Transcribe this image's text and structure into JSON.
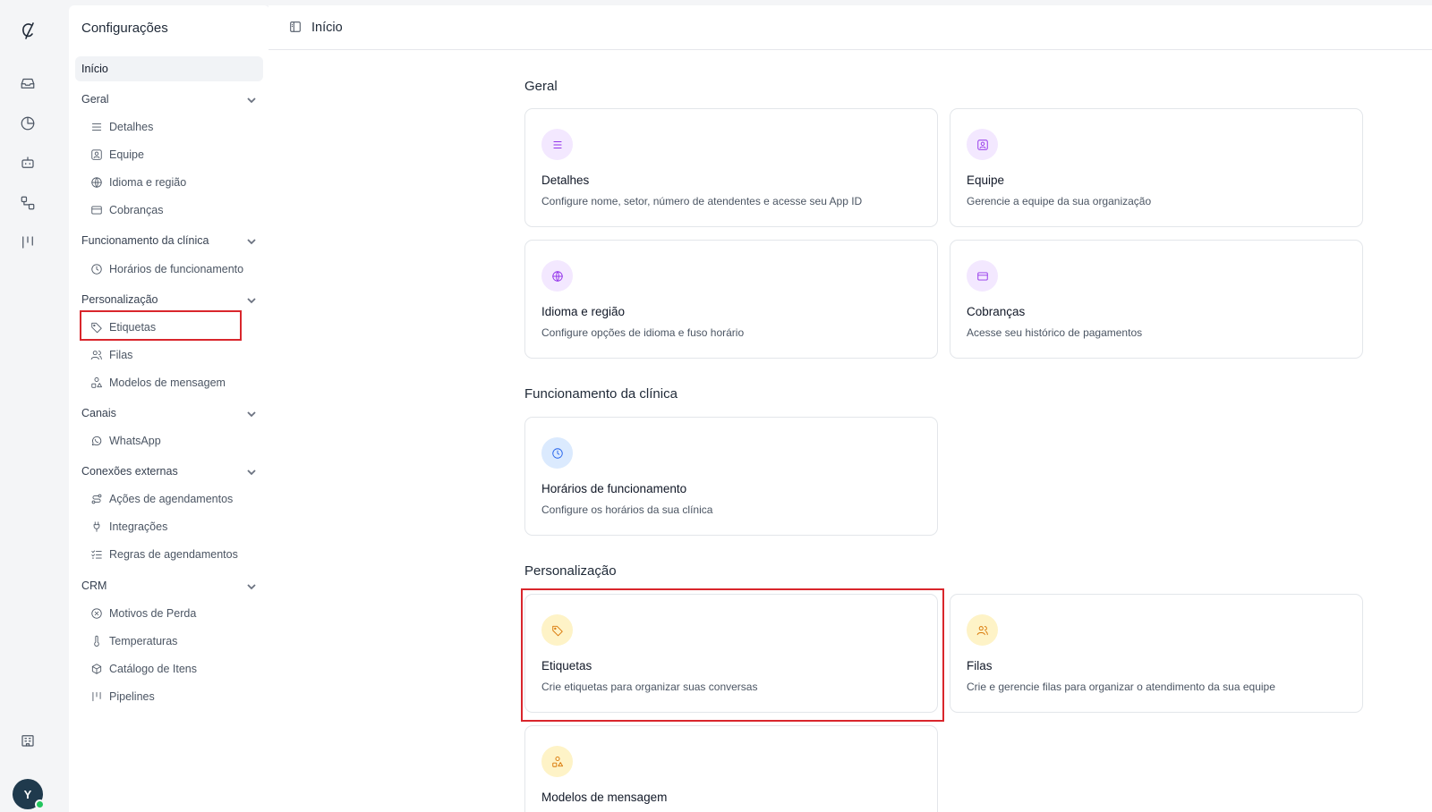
{
  "rail": {
    "items": [
      {
        "icon": "inbox-icon",
        "name": "rail-inbox"
      },
      {
        "icon": "pie-chart-icon",
        "name": "rail-reports"
      },
      {
        "icon": "bot-icon",
        "name": "rail-bot"
      },
      {
        "icon": "workflow-icon",
        "name": "rail-flows"
      },
      {
        "icon": "pipeline-icon",
        "name": "rail-pipeline"
      }
    ],
    "avatar_initial": "Y",
    "colors": {
      "avatar": "#1f3a4d",
      "online": "#22c55e"
    }
  },
  "sidebar": {
    "title": "Configurações",
    "home": "Início",
    "sections": [
      {
        "label": "Geral",
        "items": [
          {
            "label": "Detalhes",
            "icon": "list-icon"
          },
          {
            "label": "Equipe",
            "icon": "team-icon"
          },
          {
            "label": "Idioma e região",
            "icon": "globe-icon"
          },
          {
            "label": "Cobranças",
            "icon": "card-icon"
          }
        ]
      },
      {
        "label": "Funcionamento da clínica",
        "items": [
          {
            "label": "Horários de funcionamento",
            "icon": "clock-icon"
          }
        ]
      },
      {
        "label": "Personalização",
        "items": [
          {
            "label": "Etiquetas",
            "icon": "tag-icon"
          },
          {
            "label": "Filas",
            "icon": "users-icon"
          },
          {
            "label": "Modelos de mensagem",
            "icon": "shapes-icon"
          }
        ]
      },
      {
        "label": "Canais",
        "items": [
          {
            "label": "WhatsApp",
            "icon": "whatsapp-icon"
          }
        ]
      },
      {
        "label": "Conexões externas",
        "items": [
          {
            "label": "Ações de agendamentos",
            "icon": "route-icon"
          },
          {
            "label": "Integrações",
            "icon": "plug-icon"
          },
          {
            "label": "Regras de agendamentos",
            "icon": "checklist-icon"
          }
        ]
      },
      {
        "label": "CRM",
        "items": [
          {
            "label": "Motivos de Perda",
            "icon": "x-circle-icon"
          },
          {
            "label": "Temperaturas",
            "icon": "thermometer-icon"
          },
          {
            "label": "Catálogo de Itens",
            "icon": "box-icon"
          },
          {
            "label": "Pipelines",
            "icon": "pipeline-icon"
          }
        ]
      }
    ]
  },
  "main": {
    "page_title": "Início",
    "groups": [
      {
        "title": "Geral",
        "cards": [
          {
            "title": "Detalhes",
            "desc": "Configure nome, setor, número de atendentes e acesse seu App ID",
            "icon": "list-icon"
          },
          {
            "title": "Equipe",
            "desc": "Gerencie a equipe da sua organização",
            "icon": "team-icon"
          },
          {
            "title": "Idioma e região",
            "desc": "Configure opções de idioma e fuso horário",
            "icon": "globe-icon"
          },
          {
            "title": "Cobranças",
            "desc": "Acesse seu histórico de pagamentos",
            "icon": "card-icon"
          }
        ]
      },
      {
        "title": "Funcionamento da clínica",
        "cards": [
          {
            "title": "Horários de funcionamento",
            "desc": "Configure os horários da sua clínica",
            "icon": "clock-icon"
          }
        ]
      },
      {
        "title": "Personalização",
        "cards": [
          {
            "title": "Etiquetas",
            "desc": "Crie etiquetas para organizar suas conversas",
            "icon": "tag-icon"
          },
          {
            "title": "Filas",
            "desc": "Crie e gerencie filas para organizar o atendimento da sua equipe",
            "icon": "users-icon"
          },
          {
            "title": "Modelos de mensagem",
            "desc": "",
            "icon": "shapes-icon"
          }
        ]
      }
    ],
    "colors": {
      "purple_bg": "#f3e8ff",
      "purple_fg": "#9333ea",
      "blue_bg": "#dbeafe",
      "blue_fg": "#2563eb",
      "amber_bg": "#fef3c7",
      "amber_fg": "#d97706",
      "highlight": "#d9262c"
    }
  }
}
